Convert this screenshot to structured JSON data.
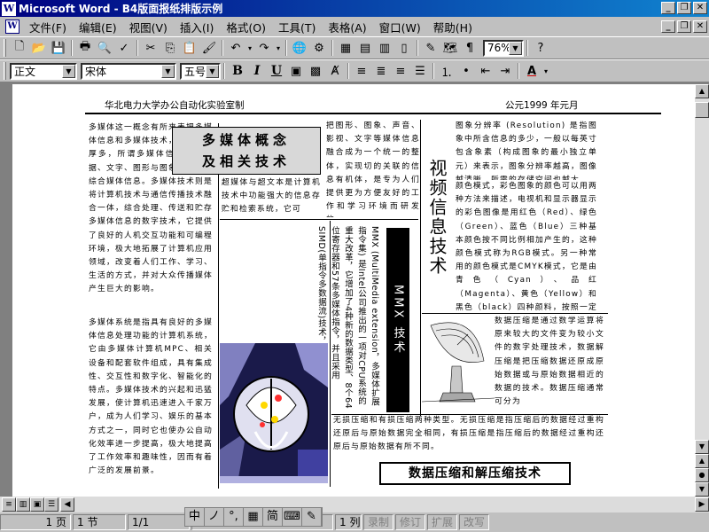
{
  "window": {
    "title": "Microsoft Word - B4版面报纸排版示例",
    "minimize": "_",
    "restore": "❐",
    "close": "✕"
  },
  "menu": [
    "文件(F)",
    "编辑(E)",
    "视图(V)",
    "插入(I)",
    "格式(O)",
    "工具(T)",
    "表格(A)",
    "窗口(W)",
    "帮助(H)"
  ],
  "toolbar": {
    "zoom": "76%",
    "style": "正文",
    "font": "宋体",
    "size": "五号",
    "bold": "B",
    "italic": "I",
    "underline": "U",
    "letter": "A"
  },
  "status": {
    "page": "1 页",
    "section": "1 节",
    "pages": "1/1",
    "col": "1 列",
    "rec": "录制",
    "trk": "修订",
    "ext": "扩展",
    "ovr": "改写"
  },
  "ime": [
    "中",
    "ノ",
    "°,",
    "▦",
    "简",
    "⌨",
    "✎"
  ],
  "doc": {
    "header_left": "华北电力大学办公自动化实验室制",
    "header_right": "公元1999 年元月",
    "title1": "多媒体概念",
    "title2": "及相关技术",
    "col1a": "多媒体这一概念有所来表把多媒体信息和多媒体技术，并以后多厚多，所谓多媒体信息是指数据、文字、图形与图象为一体的综合媒体信息。多媒体技术则是将计算机技术与通信传播技术融合一体，综合处理、传送和贮存多媒体信息的数字技术，它提供了良好的人机交互功能和可编程环境，极大地拓展了计算机应用领域，改变着人们工作、学习、生活的方式，并对大众传播媒体产生巨大的影响。",
    "col1b": "多媒体系统是指具有良好的多媒体信息处理功能的计算机系统，它由多媒体计算机MPC、相关设备和配套软件组成，具有集成性、交互性和数字化、智能化的特点。多媒体技术的兴起和迅猛发展，使计算机迅速进入千家万户，成为人们学习、娱乐的基本方式之一，同时它也使办公自动化效率进一步提高，极大地提高了工作效率和趣味性，因而有着广泛的发展前景。",
    "col2": "超媒体与超文本是计算机技术中功能强大的信息存贮和检索系统，它可",
    "col2b": "把图形、图象、声音、影视、文字等媒体信息融合成为一个统一的整体，实现切的关联的信息有机体，是专为人们提供更为方便友好的工作和学习环境而研发的。",
    "mmx_title": "MMX 技术",
    "mmx_text": "MMX (MultiMedia extension，多媒体扩展指令集) 是Intel公司推出的一项对CPU系统的重大改革，它增加了4种新的数据类型、8个64位寄存器和57条多媒体指令，并且采用SIMD(单指令多数据流)技术，同时保持与现有的操作系统和其它软件的兼容。对于图象、动画、多媒体通信、以及语音识别、听写、音频解压缩等方面的并行处理能力有显著提高。",
    "vtitle": "视频信息技术",
    "right1": "图象分辨率 (Resolution) 是指图象中所含信息的多少，一般以每英寸包含象素（构成图象的最小独立单元）来表示，图象分辨率越高，图像越清晰，所需的存储空间也越大。",
    "right2": "颜色模式，彩色图象的颜色可以用两种方法来描述，电视机和显示器显示的彩色图像是用红色（Red）、绿色（Green）、蓝色（Blue）三种基本颜色按不同比例相加产生的，这种颜色模式称为RGB模式。另一种常用的颜色模式是CMYK模式，它是由青色（Cyan）、品红（Magenta）、黄色（Yellow）和黑色（black）四种颜料，按照一定比例相减生成印刷色彩的模式，用于彩色图象的印刷与打印。",
    "right3": "数据压缩是通过数学运算将原来较大的文件变为较小文件的数字处理技术，数据解压缩是把压缩数据还原成原始数据或与原始数据相近的数据的技术。数据压缩通常可分为",
    "bottom": "无损压缩和有损压缩两种类型。无损压缩是指压缩后的数据经过重构还原后与原始数据完全相同，有损压缩是指压缩后的数据经过重构还原后与原始数据有所不同。",
    "compress_title": "数据压缩和解压缩技术"
  }
}
